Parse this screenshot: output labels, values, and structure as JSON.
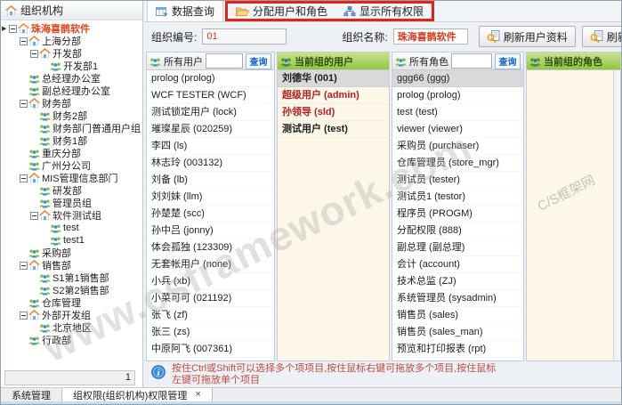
{
  "left_panel": {
    "header": {
      "title": "组织机构"
    },
    "tree": [
      {
        "label": "珠海喜鹊软件",
        "level": 0,
        "icon": "home",
        "expanded": true,
        "red": true,
        "marked": true
      },
      {
        "label": "上海分部",
        "level": 1,
        "icon": "home",
        "expanded": true
      },
      {
        "label": "开发部",
        "level": 2,
        "icon": "home",
        "expanded": true
      },
      {
        "label": "开发部1",
        "level": 3,
        "icon": "group"
      },
      {
        "label": "总经理办公室",
        "level": 1,
        "icon": "group"
      },
      {
        "label": "副总经理办公室",
        "level": 1,
        "icon": "group"
      },
      {
        "label": "财务部",
        "level": 1,
        "icon": "home",
        "expanded": true
      },
      {
        "label": "财务2部",
        "level": 2,
        "icon": "group"
      },
      {
        "label": "财务部门普通用户组",
        "level": 2,
        "icon": "group"
      },
      {
        "label": "财务1部",
        "level": 2,
        "icon": "group"
      },
      {
        "label": "重庆分部",
        "level": 1,
        "icon": "group"
      },
      {
        "label": "广州分公司",
        "level": 1,
        "icon": "group"
      },
      {
        "label": "MIS管理信息部门",
        "level": 1,
        "icon": "home",
        "expanded": true
      },
      {
        "label": "研发部",
        "level": 2,
        "icon": "group"
      },
      {
        "label": "管理员组",
        "level": 2,
        "icon": "group"
      },
      {
        "label": "软件测试组",
        "level": 2,
        "icon": "home",
        "expanded": true
      },
      {
        "label": "test",
        "level": 3,
        "icon": "group"
      },
      {
        "label": "test1",
        "level": 3,
        "icon": "group"
      },
      {
        "label": "采购部",
        "level": 1,
        "icon": "group"
      },
      {
        "label": "销售部",
        "level": 1,
        "icon": "home",
        "expanded": true
      },
      {
        "label": "S1第1销售部",
        "level": 2,
        "icon": "group"
      },
      {
        "label": "S2第2销售部",
        "level": 2,
        "icon": "group"
      },
      {
        "label": "仓库管理",
        "level": 1,
        "icon": "group"
      },
      {
        "label": "外部开发组",
        "level": 1,
        "icon": "home",
        "expanded": true
      },
      {
        "label": "北京地区",
        "level": 2,
        "icon": "group"
      },
      {
        "label": "行政部",
        "level": 1,
        "icon": "group"
      }
    ],
    "status_value": "1"
  },
  "toolbar": {
    "tabs": [
      {
        "label": "数据查询"
      },
      {
        "label": "分配用户和角色"
      },
      {
        "label": "显示所有权限"
      }
    ]
  },
  "form": {
    "org_code_label": "组织编号:",
    "org_code_value": "01",
    "org_name_label": "组织名称:",
    "org_name_value": "珠海喜鹊软件",
    "refresh_users_label": "刷新用户资料",
    "refresh_roles_label": "刷新角色资料"
  },
  "columns": {
    "all_users": {
      "title": "所有用户",
      "search_value": "",
      "search_button": "查询",
      "items": [
        {
          "text": "prolog (prolog)"
        },
        {
          "text": "WCF TESTER (WCF)"
        },
        {
          "text": "测试锁定用户 (lock)"
        },
        {
          "text": "璀璨星辰 (020259)"
        },
        {
          "text": "李四 (ls)"
        },
        {
          "text": "林志玲 (003132)"
        },
        {
          "text": "刘备 (lb)"
        },
        {
          "text": "刘刘妹 (llm)"
        },
        {
          "text": "孙楚楚 (scc)"
        },
        {
          "text": "孙中吕 (jonny)"
        },
        {
          "text": "体会孤独 (123309)"
        },
        {
          "text": "无套帐用户 (none)"
        },
        {
          "text": "小兵 (xb)"
        },
        {
          "text": "小菜可可 (021192)"
        },
        {
          "text": "张飞 (zf)"
        },
        {
          "text": "张三 (zs)"
        },
        {
          "text": "中原阿飞 (007361)"
        }
      ]
    },
    "group_users": {
      "title": "当前组的用户",
      "items": [
        {
          "text": "刘德华 (001)",
          "selected": true
        },
        {
          "text": "超级用户 (admin)",
          "red": true
        },
        {
          "text": "孙领导 (sld)",
          "red": true
        },
        {
          "text": "测试用户 (test)"
        }
      ]
    },
    "all_roles": {
      "title": "所有角色",
      "search_value": "",
      "search_button": "查询",
      "items": [
        {
          "text": "ggg66 (ggg)",
          "selected": true
        },
        {
          "text": "prolog (prolog)"
        },
        {
          "text": "test (test)"
        },
        {
          "text": "viewer (viewer)"
        },
        {
          "text": "采购员 (purchaser)"
        },
        {
          "text": "仓库管理员 (store_mgr)"
        },
        {
          "text": "测试员 (tester)"
        },
        {
          "text": "测试员1 (testor)"
        },
        {
          "text": "程序员 (PROGM)"
        },
        {
          "text": "分配权限 (888)"
        },
        {
          "text": "副总理 (副总理)"
        },
        {
          "text": "会计 (account)"
        },
        {
          "text": "技术总监 (ZJ)"
        },
        {
          "text": "系统管理员 (sysadmin)"
        },
        {
          "text": "销售员 (sales)"
        },
        {
          "text": "销售员 (sales_man)"
        },
        {
          "text": "预览和打印报表 (rpt)"
        }
      ]
    },
    "group_roles": {
      "title": "当前组的角色",
      "items": []
    }
  },
  "hint": {
    "text": "按住Ctrl或Shift可以选择多个项项目,按住鼠标右键可拖放多个项目,按住鼠标左键可拖放单个项目"
  },
  "bottom_tabs": {
    "tabs": [
      {
        "label": "系统管理"
      },
      {
        "label": "组权限(组织机构)权限管理",
        "closable": true
      }
    ]
  },
  "watermark": {
    "primary": "www.csframework.com",
    "secondary": "C/S框架网"
  },
  "colors": {
    "annotation_red": "#E0241A",
    "selected_org_text": "#E2471D",
    "group_header_green": "#8FC540",
    "value_red": "#D23C1E",
    "hint_red": "#BE4B42",
    "cream_panel": "#FCF7E8"
  }
}
